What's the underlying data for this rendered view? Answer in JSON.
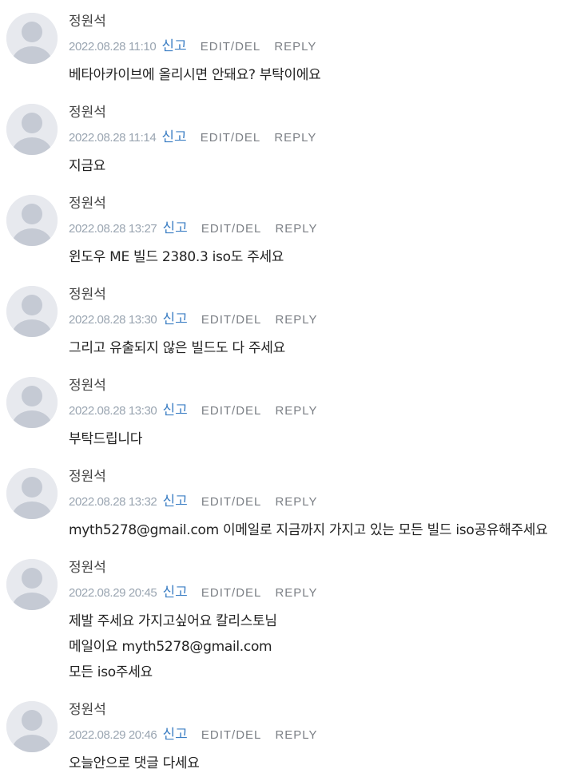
{
  "comments": [
    {
      "author": "정원석",
      "date": "2022.08.28 11:10",
      "report_label": "신고",
      "edit_label": "EDIT/DEL",
      "reply_label": "REPLY",
      "lines": [
        "베타아카이브에 올리시면 안돼요? 부탁이에요"
      ]
    },
    {
      "author": "정원석",
      "date": "2022.08.28 11:14",
      "report_label": "신고",
      "edit_label": "EDIT/DEL",
      "reply_label": "REPLY",
      "lines": [
        "지금요"
      ]
    },
    {
      "author": "정원석",
      "date": "2022.08.28 13:27",
      "report_label": "신고",
      "edit_label": "EDIT/DEL",
      "reply_label": "REPLY",
      "lines": [
        "윈도우 ME 빌드 2380.3 iso도 주세요"
      ]
    },
    {
      "author": "정원석",
      "date": "2022.08.28 13:30",
      "report_label": "신고",
      "edit_label": "EDIT/DEL",
      "reply_label": "REPLY",
      "lines": [
        "그리고 유출되지 않은 빌드도 다 주세요"
      ]
    },
    {
      "author": "정원석",
      "date": "2022.08.28 13:30",
      "report_label": "신고",
      "edit_label": "EDIT/DEL",
      "reply_label": "REPLY",
      "lines": [
        "부탁드립니다"
      ]
    },
    {
      "author": "정원석",
      "date": "2022.08.28 13:32",
      "report_label": "신고",
      "edit_label": "EDIT/DEL",
      "reply_label": "REPLY",
      "lines": [
        "myth5278@gmail.com 이메일로 지금까지 가지고 있는 모든 빌드 iso공유해주세요"
      ]
    },
    {
      "author": "정원석",
      "date": "2022.08.29 20:45",
      "report_label": "신고",
      "edit_label": "EDIT/DEL",
      "reply_label": "REPLY",
      "lines": [
        "제발 주세요 가지고싶어요 칼리스토님",
        "메일이요 myth5278@gmail.com",
        "모든 iso주세요"
      ]
    },
    {
      "author": "정원석",
      "date": "2022.08.29 20:46",
      "report_label": "신고",
      "edit_label": "EDIT/DEL",
      "reply_label": "REPLY",
      "lines": [
        "오늘안으로 댓글 다세요"
      ]
    }
  ],
  "colors": {
    "date": "#9aa5b1",
    "report_link": "#3d7fc4",
    "action": "#7b7f85",
    "avatar_bg": "#e7e9ee",
    "avatar_figure": "#c5cad4"
  },
  "icons": {
    "avatar": "default-user-silhouette-icon"
  }
}
